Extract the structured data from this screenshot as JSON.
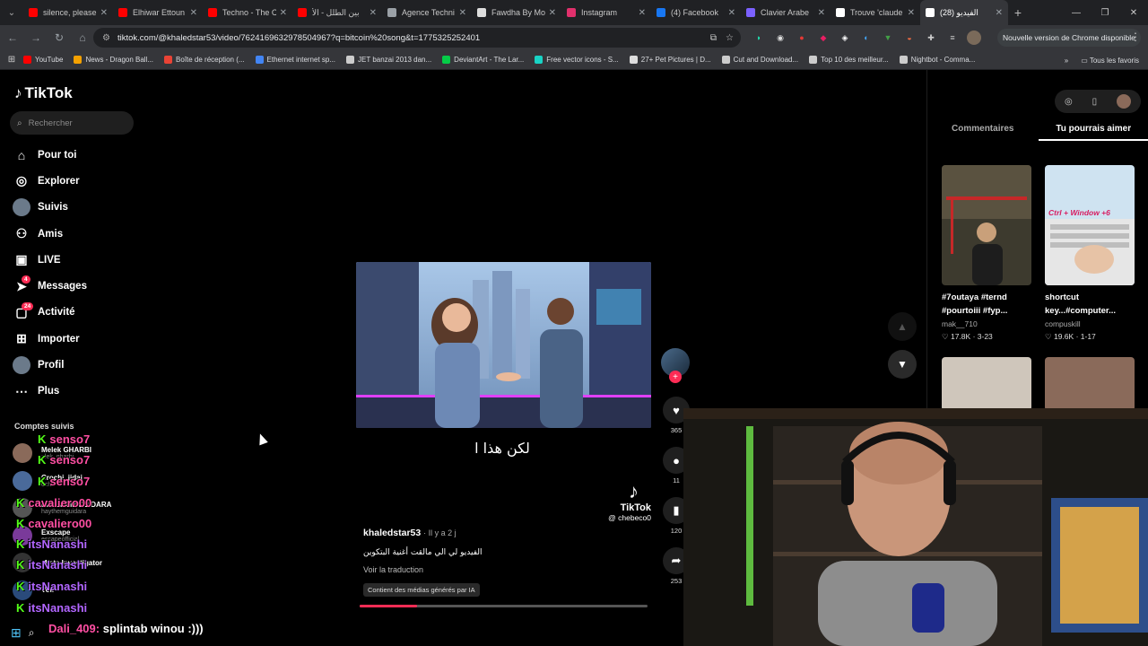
{
  "browser": {
    "tabs": [
      {
        "title": "silence, please",
        "color": "#ff0000"
      },
      {
        "title": "Elhiwar Ettoun",
        "color": "#ff0000"
      },
      {
        "title": "Techno - The C",
        "color": "#ff0000"
      },
      {
        "title": "بين الطلل - الأ",
        "color": "#ff0000"
      },
      {
        "title": "Agence Techni",
        "color": "#9aa0a6"
      },
      {
        "title": "Fawdha By Mo",
        "color": "#dddddd"
      },
      {
        "title": "Instagram",
        "color": "#e1306c"
      },
      {
        "title": "(4) Facebook",
        "color": "#1877f2"
      },
      {
        "title": "Clavier Arabe",
        "color": "#7b61ff"
      },
      {
        "title": "Trouve 'claude",
        "color": "#ffffff"
      },
      {
        "title": "(28) الفيديو",
        "color": "#ffffff",
        "active": true
      }
    ],
    "url": "tiktok.com/@khaledstar53/video/7624169632978504967?q=bitcoin%20song&t=1775325252401",
    "update_label": "Nouvelle version de Chrome disponible",
    "bookmarks": [
      {
        "label": "YouTube",
        "color": "#ff0000"
      },
      {
        "label": "News - Dragon Ball...",
        "color": "#f4a100"
      },
      {
        "label": "Boîte de réception (...",
        "color": "#ea4335"
      },
      {
        "label": "Ethernet internet sp...",
        "color": "#4285f4"
      },
      {
        "label": "JET banzai 2013 dan...",
        "color": "#cccccc"
      },
      {
        "label": "DeviantArt - The Lar...",
        "color": "#05cc47"
      },
      {
        "label": "Free vector icons - S...",
        "color": "#19d3c5"
      },
      {
        "label": "27+ Pet Pictures | D...",
        "color": "#dddddd"
      },
      {
        "label": "Cut and Download...",
        "color": "#cccccc"
      },
      {
        "label": "Top 10 des meilleur...",
        "color": "#cccccc"
      },
      {
        "label": "Nightbot - Comma...",
        "color": "#cccccc"
      }
    ],
    "bookmarks_all": "Tous les favoris"
  },
  "tiktok": {
    "logo": "TikTok",
    "search_placeholder": "Rechercher",
    "nav": [
      {
        "label": "Pour toi",
        "icon": "home-icon",
        "glyph": "⌂"
      },
      {
        "label": "Explorer",
        "icon": "compass-icon",
        "glyph": "◎"
      },
      {
        "label": "Suivis",
        "icon": "avatar-icon",
        "glyph": ""
      },
      {
        "label": "Amis",
        "icon": "friends-icon",
        "glyph": "⚇"
      },
      {
        "label": "LIVE",
        "icon": "live-icon",
        "glyph": "▣"
      },
      {
        "label": "Messages",
        "icon": "messages-icon",
        "glyph": "➤",
        "badge": "4"
      },
      {
        "label": "Activité",
        "icon": "activity-icon",
        "glyph": "▢",
        "badge": "24"
      },
      {
        "label": "Importer",
        "icon": "upload-icon",
        "glyph": "⊞"
      },
      {
        "label": "Profil",
        "icon": "profile-avatar-icon",
        "glyph": ""
      },
      {
        "label": "Plus",
        "icon": "more-icon",
        "glyph": "⋯"
      }
    ],
    "following_title": "Comptes suivis",
    "following": [
      {
        "name": "Melek GHARBI",
        "sub": "alek_gharbi",
        "color": "#8a6a5a"
      },
      {
        "name": "Crochi_jidai",
        "sub": "ochi",
        "color": "#4a6a9a"
      },
      {
        "name": "HAYTHEM GUIDARA",
        "sub": "haythemguidara",
        "color": "#555555"
      },
      {
        "name": "Exscape",
        "sub": "escapeofficial",
        "color": "#7a3a9a"
      },
      {
        "name": "Mista Investigator",
        "sub": "",
        "color": "#333333"
      },
      {
        "name": "Voir",
        "sub": "",
        "color": "#2a4a7a"
      }
    ],
    "video": {
      "subtitle": "لكن هذا ا",
      "watermark": "TikTok",
      "watermark_user": "@ chebeco0",
      "author": "khaledstar53",
      "when": "· Il y a 2 j",
      "caption": "الفيديو لي الي مالقت أغنية البتكوين",
      "translate": "Voir la traduction",
      "ai_tag": "Contient des médias générés par IA",
      "progress": 0.2
    },
    "actions": {
      "likes": "365",
      "comments": "11",
      "saves": "120",
      "shares": "253"
    },
    "right_panel": {
      "tab_comments": "Commentaires",
      "tab_suggested": "Tu pourrais aimer",
      "items": [
        {
          "title": "#7outaya #ternd #pourtoiii #fyp...",
          "author": "mak__710",
          "likes": "17.8K",
          "date": "3-23"
        },
        {
          "title": "shortcut key...#computer...",
          "author": "compuskill",
          "likes": "19.6K",
          "date": "1-17",
          "overlay": "Ctrl + Window +6"
        }
      ]
    }
  },
  "stream_overlay": {
    "chat": [
      {
        "user": "senso7",
        "color": "#ff4fa3"
      },
      {
        "user": "senso7",
        "color": "#ff4fa3"
      },
      {
        "user": "senso7",
        "color": "#ff4fa3"
      },
      {
        "user": "cavaliero00",
        "color": "#ff4fa3"
      },
      {
        "user": "cavaliero00",
        "color": "#ff4fa3"
      },
      {
        "user": "itsNanashi",
        "color": "#b266ff"
      },
      {
        "user": "itsNanashi",
        "color": "#b266ff"
      },
      {
        "user": "itsNanashi",
        "color": "#b266ff"
      },
      {
        "user": "itsNanashi",
        "color": "#b266ff"
      }
    ],
    "last_user": "Dali_409:",
    "last_message": "splintab winou :)))"
  }
}
